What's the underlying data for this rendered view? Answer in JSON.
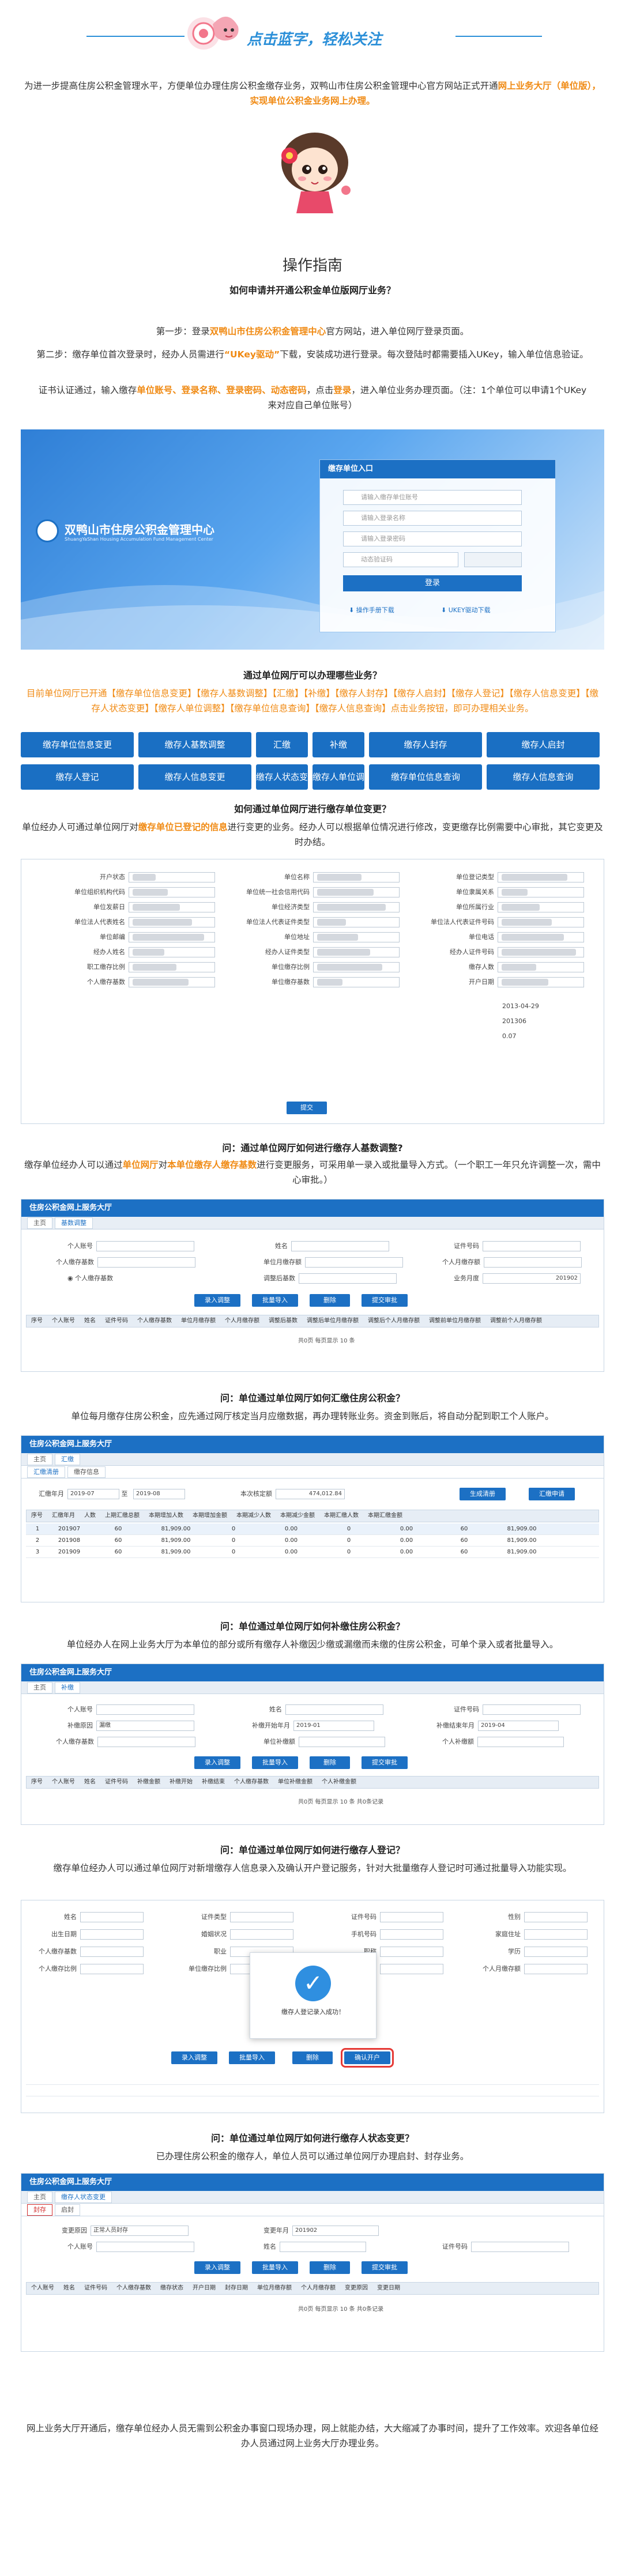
{
  "header": {
    "subscribe_text": "点击蓝字，轻松关注"
  },
  "intro": {
    "part1": "为进一步提高住房公积金管理水平，方便单位办理住房公积金缴存业务，双鸭山市住房公积金管理中心官方网站正式开通",
    "part2": "网上业务大厅（单位版），实现单位公积金业务网上办理。"
  },
  "guide": {
    "title": "操作指南",
    "q1": "如何申请并开通公积金单位版网厅业务？",
    "step1_a": "第一步：登录",
    "step1_hl": "双鸭山市住房公积金管理中心",
    "step1_b": "官方网站，进入单位网厅登录页面。",
    "step2_a": "第二步：缴存单位首次登录时，经办人员需进行",
    "step2_hl": "“UKey驱动”",
    "step2_b": "下载，安装成功进行登录。每次登陆时都需要插入UKey，输入单位信息验证。",
    "step3_a": "证书认证通过，输入缴存",
    "step3_hl": "单位账号、登录名称、登录密码、动态密码",
    "step3_b": "，点击",
    "step3_hl2": "登录",
    "step3_c": "，进入单位业务办理页面。（注：1个单位可以申请1个UKey来对应自己单位账号）"
  },
  "login": {
    "org_name": "双鸭山市住房公积金管理中心",
    "org_name_en": "ShuangYaShan Housing Accumulation Fund Management Center",
    "panel_title": "缴存单位入口",
    "field1": "请输入缴存单位账号",
    "field2": "请输入登录名称",
    "field3": "请输入登录密码",
    "field4": "动态验证码",
    "login_button": "登录",
    "dl1": "操作手册下载",
    "dl2": "UKEY驱动下载"
  },
  "business": {
    "q": "通过单位网厅可以办理哪些业务？",
    "desc": "目前单位网厅已开通【缴存单位信息变更】【缴存人基数调整】【汇缴】【补缴】【缴存人封存】【缴存人启封】【缴存人登记】【缴存人信息变更】【缴存人状态变更】【缴存人单位调整】【缴存单位信息查询】【缴存人信息查询】点击业务按钮，即可办理相关业务。",
    "buttons": [
      "缴存单位信息变更",
      "缴存人基数调整",
      "汇缴",
      "补缴",
      "缴存人封存",
      "缴存人启封",
      "缴存人登记",
      "缴存人信息变更",
      "缴存人状态变更",
      "缴存人单位调整",
      "缴存单位信息查询",
      "缴存人信息查询"
    ]
  },
  "s1": {
    "q": "如何通过单位网厅进行缴存单位变更？",
    "desc_a": "单位经办人可通过单位网厅对",
    "desc_hl": "缴存单位已登记的信息",
    "desc_b": "进行变更的业务。经办人可以根据单位情况进行修改，变更缴存比例需要中心审批，其它变更及时办结。",
    "labels": [
      "开户状态",
      "单位名称",
      "单位登记类型",
      "单位组织机构代码",
      "单位统一社会信用代码",
      "单位隶属关系",
      "单位发薪日",
      "单位经济类型",
      "单位所属行业",
      "单位法人代表姓名",
      "单位法人代表证件类型",
      "单位法人代表证件号码",
      "单位邮编",
      "单位地址",
      "单位电话",
      "经办人姓名",
      "经办人证件类型",
      "经办人证件号码",
      "职工缴存比例",
      "单位缴存比例",
      "缴存人数",
      "个人缴存基数",
      "单位缴存基数",
      "开户日期"
    ],
    "values": {
      "open_date": "2013-04-29",
      "people": "201306",
      "rate": "0.07",
      "submit": "提交"
    }
  },
  "s2": {
    "q": "问：通过单位网厅如何进行缴存人基数调整?",
    "desc_a": "缴存单位经办人可以通过",
    "desc_hl1": "单位网厅",
    "desc_b": "对",
    "desc_hl2": "本单位缴存人缴存基数",
    "desc_c": "进行变更服务，可采用单一录入或批量导入方式。（一个职工一年只允许调整一次，需中心审批。）",
    "bar": "住房公积金网上服务大厅",
    "tab1": "主页",
    "tab2": "基数调整",
    "f1": "个人账号",
    "f2": "姓名",
    "f3": "证件号码",
    "f4": "个人缴存基数",
    "f5": "单位月缴存额",
    "f6": "个人月缴存额",
    "f7": "调整后基数",
    "f8": "业务月度",
    "radio": "个人缴存基数",
    "month": "201902",
    "b1": "录入调整",
    "b2": "批量导入",
    "b3": "删除",
    "b4": "提交审批",
    "cols": [
      "序号",
      "个人账号",
      "姓名",
      "证件号码",
      "个人缴存基数",
      "单位月缴存额",
      "个人月缴存额",
      "调整后基数",
      "调整后单位月缴存额",
      "调整后个人月缴存额",
      "调整前单位月缴存额",
      "调整前个人月缴存额"
    ],
    "pager": "共0页 每页显示 10 条"
  },
  "s3": {
    "q": "问：单位通过单位网厅如何汇缴住房公积金？",
    "desc": "单位每月缴存住房公积金，应先通过网厅核定当月应缴数据，再办理转账业务。资金到账后，将自动分配到职工个人账户。",
    "bar": "住房公积金网上服务大厅",
    "tab1": "主页",
    "tab2": "汇缴",
    "sub1": "汇缴清册",
    "sub2": "缴存信息",
    "l1": "汇缴年月",
    "from": "2019-07",
    "to": "2019-08",
    "l2": "本次核定额",
    "amount": "474,012.84",
    "btn1": "生成清册",
    "btn2": "汇缴申请",
    "cols": [
      "序号",
      "汇缴年月",
      "人数",
      "上期汇缴总额",
      "本期增加人数",
      "本期增加金额",
      "本期减少人数",
      "本期减少金额",
      "本期汇缴人数",
      "本期汇缴金额"
    ],
    "rows": [
      [
        "1",
        "201907",
        "60",
        "81,909.00",
        "0",
        "0.00",
        "0",
        "0.00",
        "60",
        "81,909.00"
      ],
      [
        "2",
        "201908",
        "60",
        "81,909.00",
        "0",
        "0.00",
        "0",
        "0.00",
        "60",
        "81,909.00"
      ],
      [
        "3",
        "201909",
        "60",
        "81,909.00",
        "0",
        "0.00",
        "0",
        "0.00",
        "60",
        "81,909.00"
      ]
    ]
  },
  "s4": {
    "q": "问：单位通过单位网厅如何补缴住房公积金？",
    "desc": "单位经办人在网上业务大厅为本单位的部分或所有缴存人补缴因少缴或漏缴而未缴的住房公积金，可单个录入或者批量导入。",
    "bar": "住房公积金网上服务大厅",
    "tab1": "主页",
    "tab2": "补缴",
    "f1": "个人账号",
    "f2": "姓名",
    "f3": "证件号码",
    "f4": "补缴原因",
    "f5": "补缴开始年月",
    "f6": "补缴结束年月",
    "f7": "个人缴存基数",
    "f8": "单位补缴额",
    "f9": "个人补缴额",
    "reason": "漏缴",
    "start": "2019-01",
    "end": "2019-04",
    "b1": "录入调整",
    "b2": "批量导入",
    "b3": "删除",
    "b4": "提交审批",
    "cols": [
      "序号",
      "个人账号",
      "姓名",
      "证件号码",
      "补缴金额",
      "补缴开始",
      "补缴结束",
      "个人缴存基数",
      "单位补缴金额",
      "个人补缴金额"
    ],
    "pager": "共0页 每页显示 10 条 共0条记录"
  },
  "s5": {
    "q": "问：单位通过单位网厅如何进行缴存人登记？",
    "desc": "缴存单位经办人可以通过单位网厅对新增缴存人信息录入及确认开户登记服务，针对大批量缴存人登记时可通过批量导入功能实现。",
    "toast": "缴存人登记录入成功！",
    "b1": "录入调整",
    "b2": "批量导入",
    "b3": "删除",
    "b4": "确认开户",
    "labels": [
      "姓名",
      "证件类型",
      "证件号码",
      "性别",
      "出生日期",
      "婚姻状况",
      "手机号码",
      "家庭住址",
      "个人缴存基数",
      "职业",
      "职称",
      "学历",
      "个人缴存比例",
      "单位缴存比例",
      "单位月缴存额",
      "个人月缴存额"
    ]
  },
  "s6": {
    "q": "问：单位通过单位网厅如何进行缴存人状态变更？",
    "desc": "已办理住房公积金的缴存人，单位人员可以通过单位网厅办理启封、封存业务。",
    "bar": "住房公积金网上服务大厅",
    "tab1": "主页",
    "tab2": "缴存人状态变更",
    "sub1": "封存",
    "sub2": "启封",
    "f1": "变更原因",
    "reason": "正常人员封存",
    "f2": "变更年月",
    "month": "201902",
    "f3": "个人账号",
    "f4": "姓名",
    "f5": "证件号码",
    "b1": "录入调整",
    "b2": "批量导入",
    "b3": "删除",
    "b4": "提交审批",
    "cols": [
      "个人账号",
      "姓名",
      "证件号码",
      "个人缴存基数",
      "缴存状态",
      "开户日期",
      "封存日期",
      "单位月缴存额",
      "个人月缴存额",
      "变更原因",
      "变更日期"
    ],
    "pager": "共0页 每页显示 10 条 共0条记录"
  },
  "footer": {
    "text": "网上业务大厅开通后，缴存单位经办人员无需到公积金办事窗口现场办理，网上就能办结，大大缩减了办事时间，提升了工作效率。欢迎各单位经办人员通过网上业务大厅办理业务。"
  },
  "colors": {
    "accent": "#f08a13",
    "blue": "#1c70c4",
    "pink": "#f2768b"
  }
}
